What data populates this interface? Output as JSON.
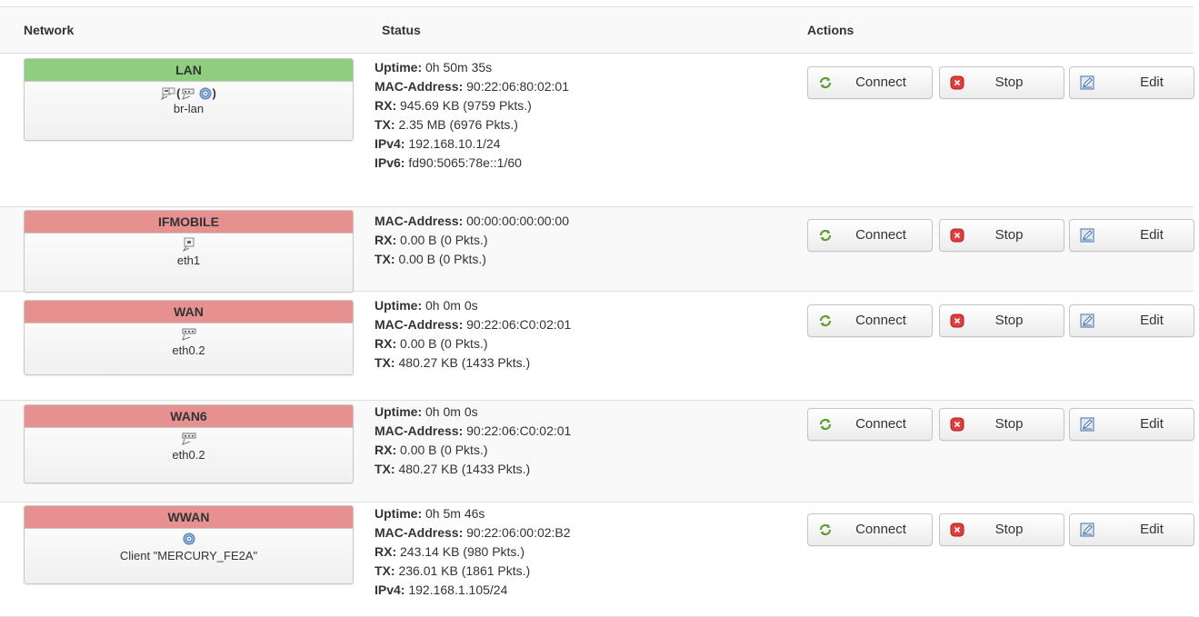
{
  "columns": {
    "network": "Network",
    "status": "Status",
    "actions": "Actions"
  },
  "buttons": {
    "connect": "Connect",
    "stop": "Stop",
    "edit": "Edit"
  },
  "colors": {
    "up": "#8fce7e",
    "down": "#e79090"
  },
  "interfaces": [
    {
      "name": "LAN",
      "state": "up",
      "device": "br-lan",
      "icon": "bridge-icon",
      "status": [
        {
          "label": "Uptime:",
          "value": " 0h 50m 35s"
        },
        {
          "label": "MAC-Address:",
          "value": " 90:22:06:80:02:01"
        },
        {
          "label": "RX:",
          "value": " 945.69 KB (9759 Pkts.)"
        },
        {
          "label": "TX:",
          "value": " 2.35 MB (6976 Pkts.)"
        },
        {
          "label": "IPv4:",
          "value": " 192.168.10.1/24"
        },
        {
          "label": "IPv6:",
          "value": " fd90:5065:78e::1/60"
        }
      ]
    },
    {
      "name": "IFMOBILE",
      "state": "down",
      "device": "eth1",
      "icon": "ethernet-port-icon",
      "status": [
        {
          "label": "MAC-Address:",
          "value": " 00:00:00:00:00:00"
        },
        {
          "label": "RX:",
          "value": " 0.00 B (0 Pkts.)"
        },
        {
          "label": "TX:",
          "value": " 0.00 B (0 Pkts.)"
        }
      ]
    },
    {
      "name": "WAN",
      "state": "down",
      "device": "eth0.2",
      "icon": "switch-icon",
      "status": [
        {
          "label": "Uptime:",
          "value": " 0h 0m 0s"
        },
        {
          "label": "MAC-Address:",
          "value": " 90:22:06:C0:02:01"
        },
        {
          "label": "RX:",
          "value": " 0.00 B (0 Pkts.)"
        },
        {
          "label": "TX:",
          "value": " 480.27 KB (1433 Pkts.)"
        }
      ]
    },
    {
      "name": "WAN6",
      "state": "down",
      "device": "eth0.2",
      "icon": "switch-icon",
      "status": [
        {
          "label": "Uptime:",
          "value": " 0h 0m 0s"
        },
        {
          "label": "MAC-Address:",
          "value": " 90:22:06:C0:02:01"
        },
        {
          "label": "RX:",
          "value": " 0.00 B (0 Pkts.)"
        },
        {
          "label": "TX:",
          "value": " 480.27 KB (1433 Pkts.)"
        }
      ]
    },
    {
      "name": "WWAN",
      "state": "down",
      "device": "Client \"MERCURY_FE2A\"",
      "icon": "wifi-icon",
      "status": [
        {
          "label": "Uptime:",
          "value": " 0h 5m 46s"
        },
        {
          "label": "MAC-Address:",
          "value": " 90:22:06:00:02:B2"
        },
        {
          "label": "RX:",
          "value": " 243.14 KB (980 Pkts.)"
        },
        {
          "label": "TX:",
          "value": " 236.01 KB (1861 Pkts.)"
        },
        {
          "label": "IPv4:",
          "value": " 192.168.1.105/24"
        }
      ]
    }
  ]
}
